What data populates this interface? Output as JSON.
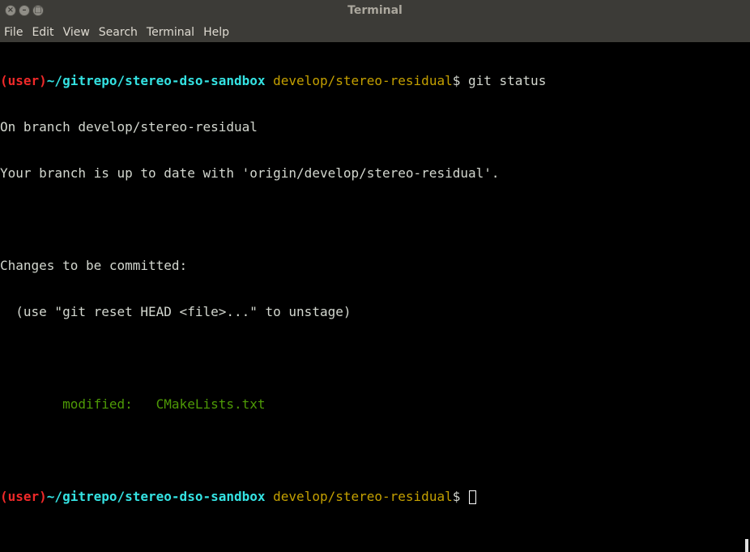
{
  "window": {
    "title": "Terminal"
  },
  "menu": [
    "File",
    "Edit",
    "View",
    "Search",
    "Terminal",
    "Help"
  ],
  "terminal": {
    "prompt_user": "(user)",
    "prompt_path": "~/gitrepo/stereo-dso-sandbox",
    "prompt_branch": "develop/stereo-residual",
    "prompt_symbol": "$",
    "command": " git status",
    "lines": [
      "On branch develop/stereo-residual",
      "Your branch is up to date with 'origin/develop/stereo-residual'.",
      "",
      "Changes to be committed:",
      "  (use \"git reset HEAD <file>...\" to unstage)",
      ""
    ],
    "modified_label": "        modified:   CMakeLists.txt",
    "colors": {
      "user": "#ef2929",
      "path": "#34e2e2",
      "branch": "#c4a000",
      "modified": "#4e9a06"
    }
  }
}
